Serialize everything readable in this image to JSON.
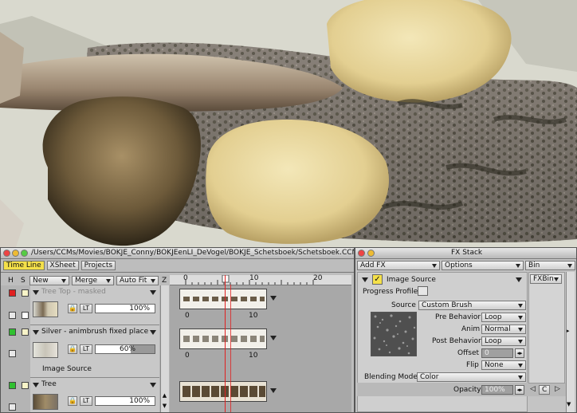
{
  "timeline": {
    "title": "/Users/CCMs/Movies/BOKJE_Conny/BOKJEenLI_DeVogel/BOKJE_Schetsboek/Schetsboek.CCM",
    "tabs": [
      "Time Line",
      "XSheet",
      "Projects"
    ],
    "header": {
      "h": "H",
      "s": "S",
      "new": "New",
      "merge": "Merge",
      "autofit": "Auto Fit",
      "z": "Z"
    },
    "ruler": {
      "t0": "0",
      "t10": "10",
      "t20": "20"
    },
    "layers": [
      {
        "name": "Tree Top - masked",
        "opacity": "100%",
        "lock": "🔒",
        "lt": "LT",
        "color": "#e02020",
        "strip0": "0",
        "strip10": "10"
      },
      {
        "name": "Silver - animbrush fixed place",
        "opacity": "60%",
        "opacity_fraction": 0.6,
        "lock": "🔒",
        "lt": "LT",
        "sub": "Image Source",
        "color": "#30c030",
        "strip0": "0",
        "strip10": "10"
      },
      {
        "name": "Tree",
        "opacity": "100%",
        "lock": "🔒",
        "lt": "LT",
        "color": "#30c030"
      }
    ]
  },
  "fx": {
    "title": "FX Stack",
    "add_fx": "Add FX",
    "options": "Options",
    "bin": "Bin",
    "fxbin": "FXBin",
    "image_source": "Image Source",
    "progress_profile": "Progress Profile",
    "source_label": "Source",
    "source_value": "Custom Brush",
    "pre_behavior_label": "Pre Behavior",
    "pre_behavior": "Loop",
    "anim_label": "Anim",
    "anim": "Normal",
    "post_behavior_label": "Post Behavior",
    "post_behavior": "Loop",
    "offset_label": "Offset",
    "offset": "0",
    "flip_label": "Flip",
    "flip": "None",
    "blending_label": "Blending Mode",
    "blending": "Color",
    "opacity_label": "Opacity",
    "opacity": "100%",
    "c_button": "C"
  }
}
